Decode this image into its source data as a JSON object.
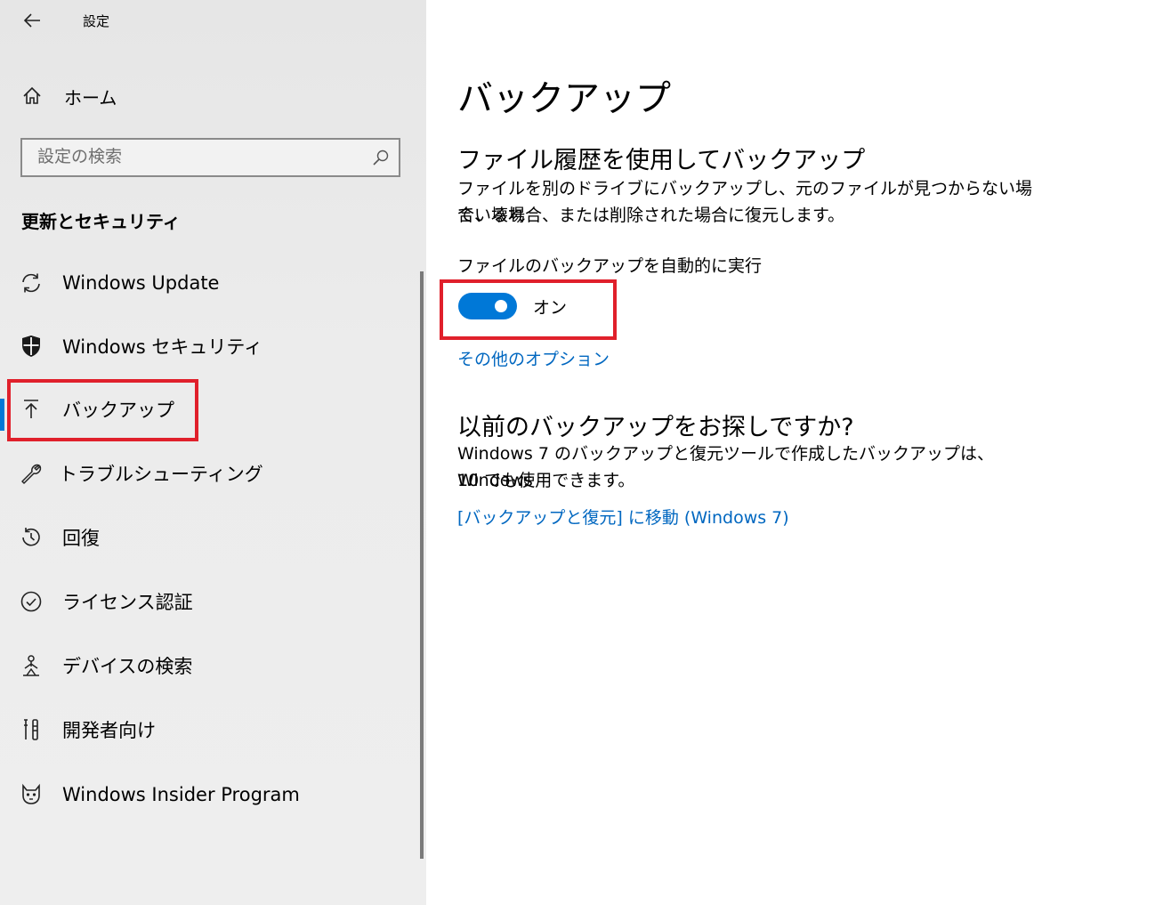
{
  "app": {
    "title": "設定"
  },
  "sidebar": {
    "home_label": "ホーム",
    "search_placeholder": "設定の検索",
    "section_title": "更新とセキュリティ",
    "items": [
      {
        "label": "Windows Update",
        "icon": "sync-icon"
      },
      {
        "label": "Windows セキュリティ",
        "icon": "shield-icon"
      },
      {
        "label": "バックアップ",
        "icon": "backup-arrow-icon",
        "selected": true
      },
      {
        "label": "トラブルシューティング",
        "icon": "wrench-icon"
      },
      {
        "label": "回復",
        "icon": "history-icon"
      },
      {
        "label": "ライセンス認証",
        "icon": "check-circle-icon"
      },
      {
        "label": "デバイスの検索",
        "icon": "person-location-icon"
      },
      {
        "label": "開発者向け",
        "icon": "developer-tools-icon"
      },
      {
        "label": "Windows Insider Program",
        "icon": "insider-cat-icon"
      }
    ]
  },
  "main": {
    "page_title": "バックアップ",
    "file_history": {
      "heading": "ファイル履歴を使用してバックアップ",
      "description_line1": "ファイルを別のドライブにバックアップし、元のファイルが見つからない場合、壊れ",
      "description_line2": "ている場合、または削除された場合に復元します。",
      "setting_label": "ファイルのバックアップを自動的に実行",
      "toggle_state": "オン",
      "toggle_on": true,
      "more_options_link": "その他のオプション"
    },
    "older_backup": {
      "heading": "以前のバックアップをお探しですか?",
      "description_line1": "Windows 7 のバックアップと復元ツールで作成したバックアップは、Windows",
      "description_line2": "10 でも使用できます。",
      "link": "[バックアップと復元] に移動 (Windows 7)"
    }
  },
  "colors": {
    "accent": "#0078d7",
    "link": "#0067c0",
    "highlight": "#e0202b"
  }
}
